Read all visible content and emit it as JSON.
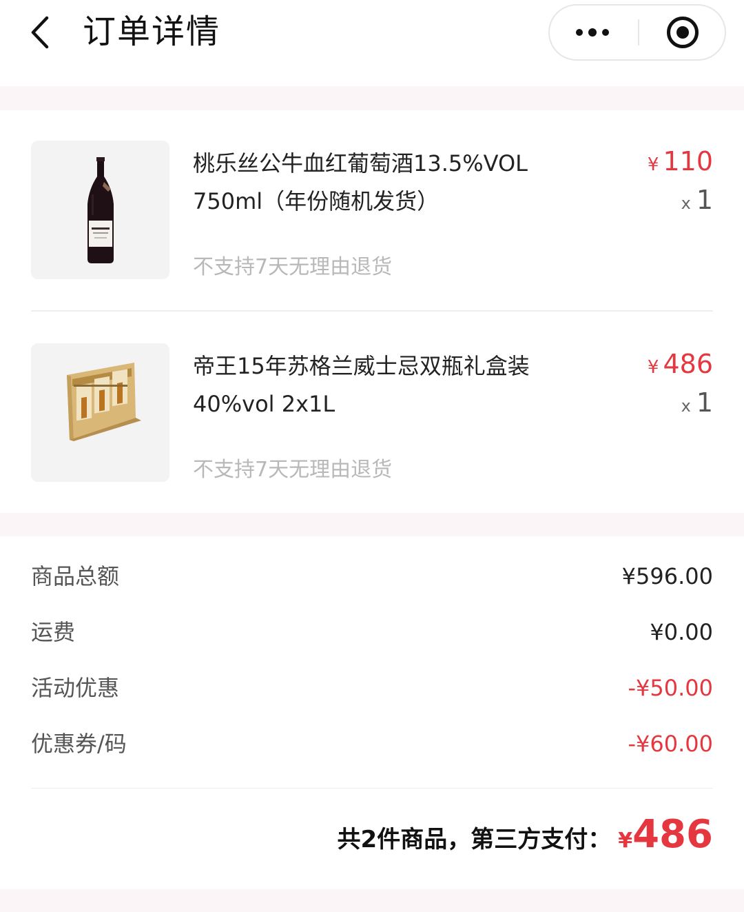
{
  "header": {
    "title": "订单详情"
  },
  "items": [
    {
      "name": "桃乐丝公牛血红葡萄酒13.5%VOL 750ml（年份随机发货）",
      "note": "不支持7天无理由退货",
      "currency": "¥",
      "price": "110",
      "qty_prefix": "x",
      "qty": "1"
    },
    {
      "name": "帝王15年苏格兰威士忌双瓶礼盒装40%vol 2x1L",
      "note": "不支持7天无理由退货",
      "currency": "¥",
      "price": "486",
      "qty_prefix": "x",
      "qty": "1"
    }
  ],
  "summary": {
    "goods_total_label": "商品总额",
    "goods_total_value": "¥596.00",
    "shipping_label": "运费",
    "shipping_value": "¥0.00",
    "promo_label": "活动优惠",
    "promo_value": "-¥50.00",
    "coupon_label": "优惠券/码",
    "coupon_value": "-¥60.00"
  },
  "total": {
    "text": "共2件商品，第三方支付：",
    "currency": "¥",
    "amount": "486"
  },
  "colors": {
    "accent": "#e5373f",
    "section_gap": "#fbf5f7"
  }
}
